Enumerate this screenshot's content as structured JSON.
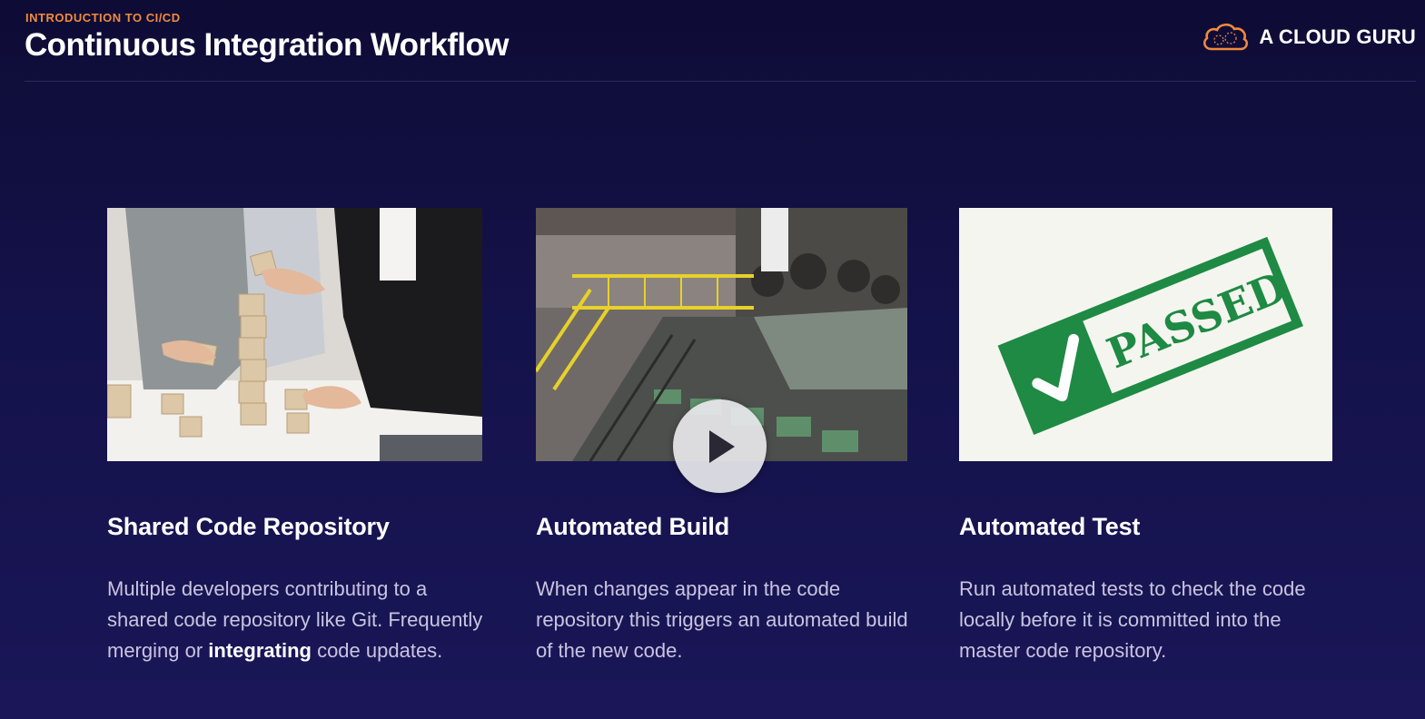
{
  "header": {
    "eyebrow": "INTRODUCTION TO CI/CD",
    "title": "Continuous Integration Workflow",
    "brand": "A CLOUD GURU"
  },
  "cards": [
    {
      "title": "Shared Code Repository",
      "body_before": "Multiple developers contributing to a shared code repository like Git. Frequently merging or ",
      "body_bold": "integrating",
      "body_after": " code updates."
    },
    {
      "title": "Automated Build",
      "body": "When changes appear in the code repository this triggers an automated build of the new code."
    },
    {
      "title": "Automated Test",
      "body": "Run automated tests to check the code locally before it is committed into the master code repository.",
      "stamp_text": "PASSED"
    }
  ],
  "icons": [
    "cloud-logo-icon",
    "play-icon",
    "checkmark-icon"
  ],
  "colors": {
    "background": "#14124a",
    "eyebrow": "#f28a3c",
    "brand_cloud": "#f28a3c",
    "stamp_green": "#1e8a43",
    "body_text": "#c7c5df"
  }
}
